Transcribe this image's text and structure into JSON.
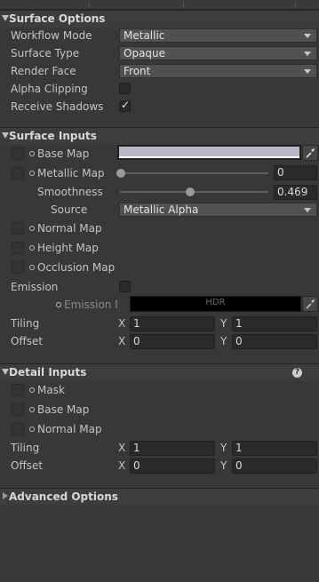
{
  "surface_options": {
    "title": "Surface Options",
    "workflow_mode": {
      "label": "Workflow Mode",
      "value": "Metallic"
    },
    "surface_type": {
      "label": "Surface Type",
      "value": "Opaque"
    },
    "render_face": {
      "label": "Render Face",
      "value": "Front"
    },
    "alpha_clipping": {
      "label": "Alpha Clipping",
      "checked": false
    },
    "receive_shadows": {
      "label": "Receive Shadows",
      "checked": true
    }
  },
  "surface_inputs": {
    "title": "Surface Inputs",
    "base_map": {
      "label": "Base Map",
      "color": "#b9b8c6"
    },
    "metallic_map": {
      "label": "Metallic Map",
      "value": "0",
      "slider": 0
    },
    "smoothness": {
      "label": "Smoothness",
      "value": "0.469",
      "slider": 0.469
    },
    "source": {
      "label": "Source",
      "value": "Metallic Alpha"
    },
    "normal_map": {
      "label": "Normal Map"
    },
    "height_map": {
      "label": "Height Map"
    },
    "occlusion_map": {
      "label": "Occlusion Map"
    },
    "emission": {
      "label": "Emission",
      "checked": false
    },
    "emission_map": {
      "label": "Emission M",
      "hdr": "HDR"
    },
    "tiling": {
      "label": "Tiling",
      "x_label": "X",
      "x": "1",
      "y_label": "Y",
      "y": "1"
    },
    "offset": {
      "label": "Offset",
      "x_label": "X",
      "x": "0",
      "y_label": "Y",
      "y": "0"
    }
  },
  "detail_inputs": {
    "title": "Detail Inputs",
    "help": "?",
    "mask": {
      "label": "Mask"
    },
    "base_map": {
      "label": "Base Map"
    },
    "normal_map": {
      "label": "Normal Map"
    },
    "tiling": {
      "label": "Tiling",
      "x_label": "X",
      "x": "1",
      "y_label": "Y",
      "y": "1"
    },
    "offset": {
      "label": "Offset",
      "x_label": "X",
      "x": "0",
      "y_label": "Y",
      "y": "0"
    }
  },
  "advanced_options": {
    "title": "Advanced Options"
  }
}
